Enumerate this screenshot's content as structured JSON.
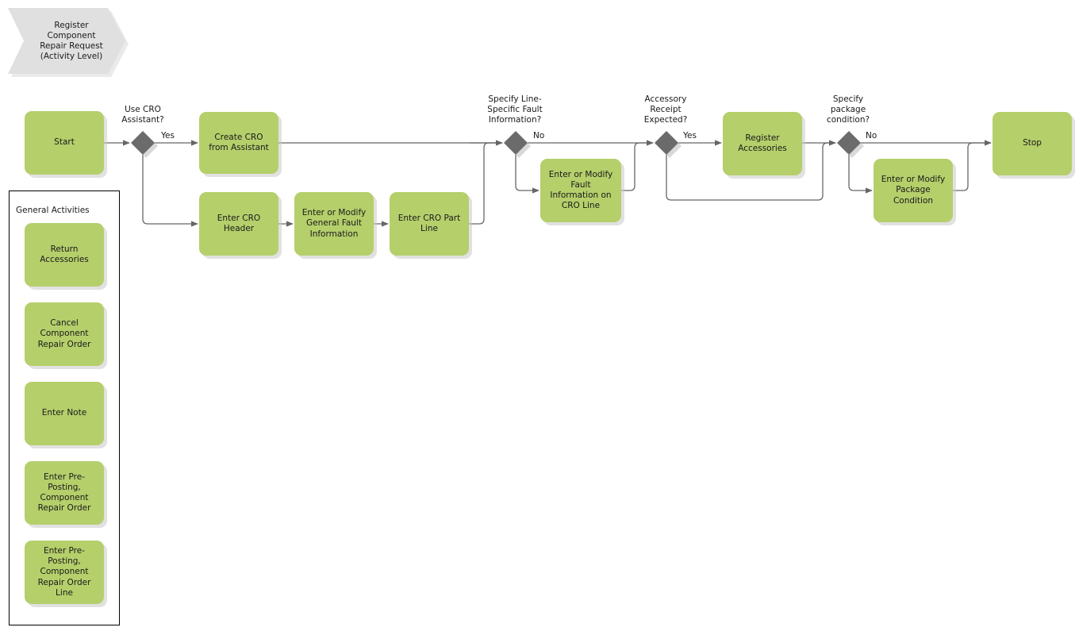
{
  "diagram": {
    "title": "Register\nComponent\nRepair Request\n(Activity Level)",
    "colors": {
      "activity_fill": "#b5cf6b",
      "gateway_fill": "#6b6b6b",
      "title_fill": "#e0e0e0",
      "edge_stroke": "#666666",
      "panel_border": "#000000"
    }
  },
  "flow": {
    "nodes": [
      {
        "id": "start",
        "label": "Start"
      },
      {
        "id": "create_cro",
        "label": "Create CRO\nfrom Assistant"
      },
      {
        "id": "enter_cro_header",
        "label": "Enter CRO\nHeader"
      },
      {
        "id": "general_fault",
        "label": "Enter or Modify\nGeneral Fault\nInformation"
      },
      {
        "id": "cro_part_line",
        "label": "Enter CRO Part\nLine"
      },
      {
        "id": "line_fault",
        "label": "Enter or Modify\nFault\nInformation on\nCRO Line"
      },
      {
        "id": "register_acc",
        "label": "Register\nAccessories"
      },
      {
        "id": "package_cond",
        "label": "Enter or Modify\nPackage\nCondition"
      },
      {
        "id": "stop",
        "label": "Stop"
      }
    ],
    "gateways": [
      {
        "id": "gw_assistant",
        "question": "Use CRO\nAssistant?",
        "branch_label": "Yes"
      },
      {
        "id": "gw_linefault",
        "question": "Specify Line-\nSpecific Fault\nInformation?",
        "branch_label": "No"
      },
      {
        "id": "gw_accessory",
        "question": "Accessory\nReceipt\nExpected?",
        "branch_label": "Yes"
      },
      {
        "id": "gw_package",
        "question": "Specify\npackage\ncondition?",
        "branch_label": "No"
      }
    ]
  },
  "panel": {
    "title": "General Activities",
    "items": [
      {
        "id": "return_accessories",
        "label": "Return\nAccessories"
      },
      {
        "id": "cancel_cro",
        "label": "Cancel\nComponent\nRepair Order"
      },
      {
        "id": "enter_note",
        "label": "Enter Note"
      },
      {
        "id": "pre_posting_cro",
        "label": "Enter Pre-\nPosting,\nComponent\nRepair Order"
      },
      {
        "id": "pre_posting_line",
        "label": "Enter Pre-\nPosting,\nComponent\nRepair Order\nLine"
      }
    ]
  }
}
